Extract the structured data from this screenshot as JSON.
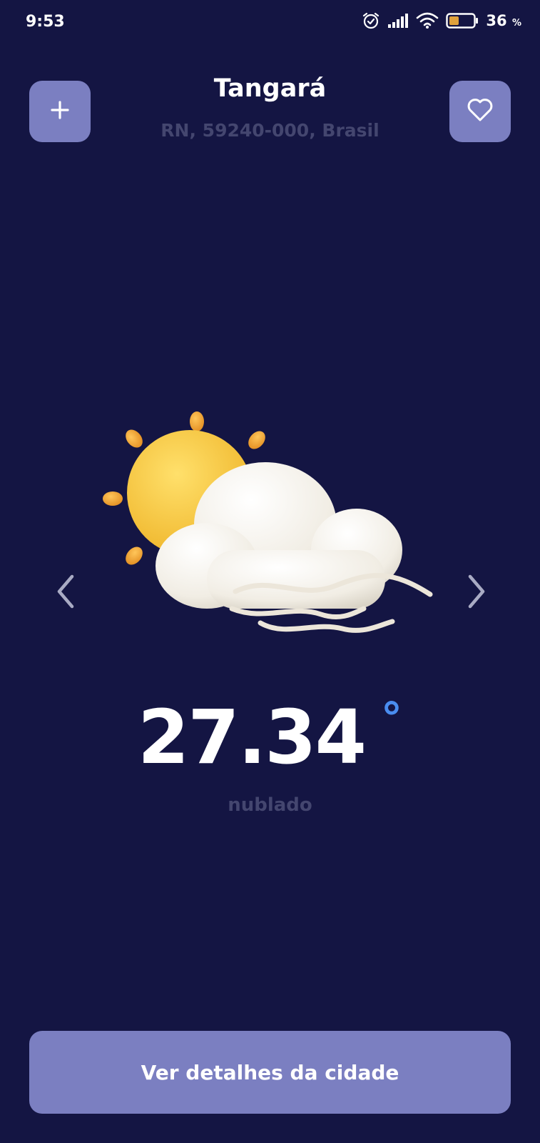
{
  "status_bar": {
    "time": "9:53",
    "battery_level": "36",
    "battery_unit": "%",
    "icons": [
      "alarm-icon",
      "signal-icon",
      "wifi-icon",
      "battery-icon"
    ]
  },
  "header": {
    "city": "Tangará",
    "subtitle": "RN, 59240-000, Brasil",
    "add_icon": "plus-icon",
    "favorite_icon": "heart-icon"
  },
  "weather": {
    "illustration": "sun-cloud-wind-icon",
    "temperature": "27.34",
    "degree_symbol": "°",
    "condition": "nublado"
  },
  "navigation": {
    "prev_icon": "chevron-left-icon",
    "next_icon": "chevron-right-icon"
  },
  "footer": {
    "details_label": "Ver detalhes da cidade"
  },
  "colors": {
    "background": "#141543",
    "accent_button": "#7b7fc1",
    "muted_text": "#44466f",
    "degree": "#4a8df0"
  }
}
